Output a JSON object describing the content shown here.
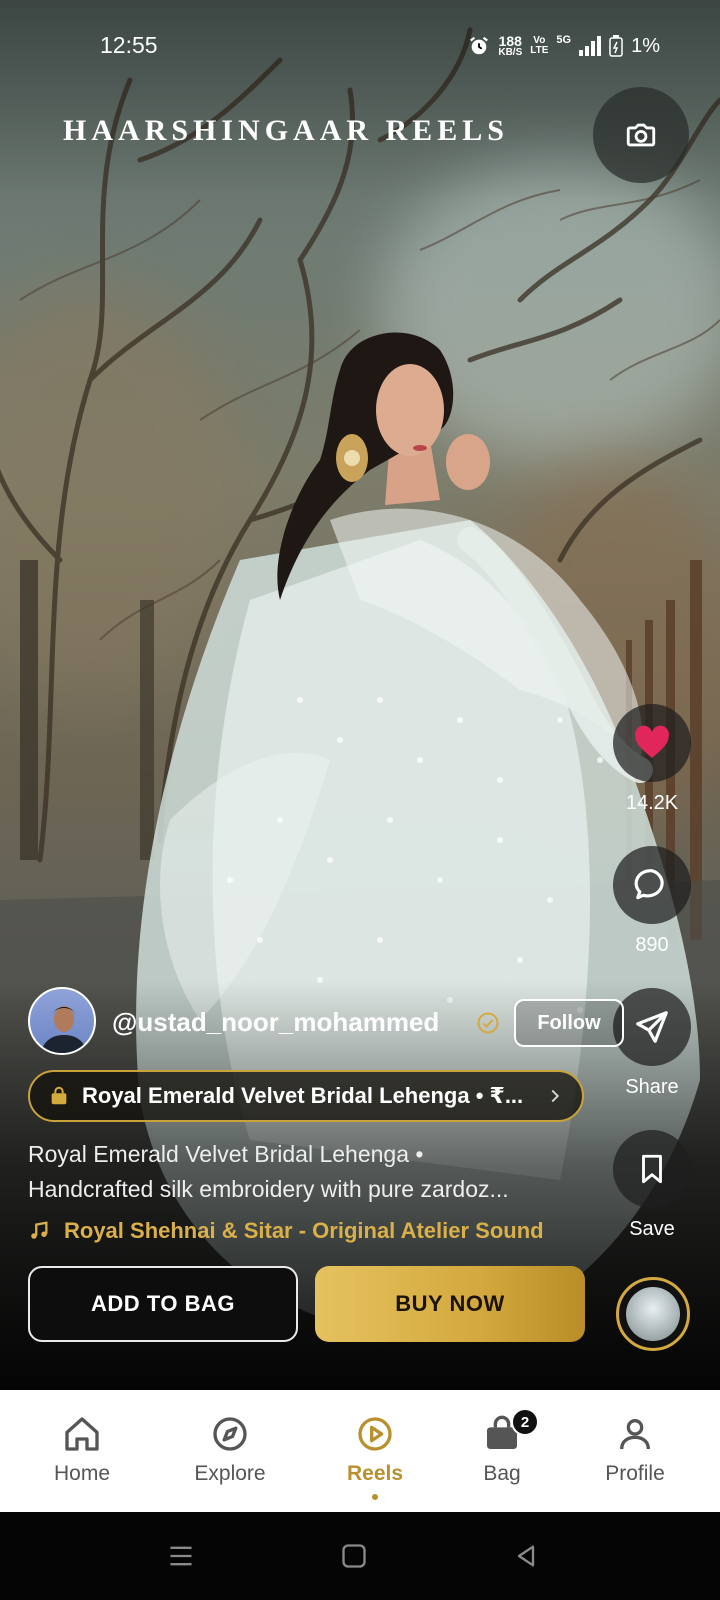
{
  "status_bar": {
    "time": "12:55",
    "speed_value": "188",
    "speed_unit": "KB/S",
    "volte_top": "Vo",
    "volte_bottom": "LTE",
    "network": "5G",
    "battery": "1%"
  },
  "header": {
    "title": "HAARSHINGAAR REELS",
    "camera_icon": "camera-icon"
  },
  "actions": {
    "like_count": "14.2K",
    "comment_count": "890",
    "share_label": "Share",
    "save_label": "Save"
  },
  "creator": {
    "username": "@ustad_noor_mohammed",
    "follow_label": "Follow"
  },
  "product": {
    "pill_text": "Royal Emerald Velvet Bridal Lehenga • ₹...",
    "caption_line1": "Royal Emerald Velvet Bridal Lehenga •",
    "caption_line2": "Handcrafted silk embroidery with pure zardoz...",
    "sound": "Royal Shehnai & Sitar - Original Atelier Sound"
  },
  "cta": {
    "add_to_bag": "ADD TO BAG",
    "buy_now": "BUY NOW"
  },
  "bottom_nav": {
    "items": [
      {
        "label": "Home",
        "icon": "home-icon"
      },
      {
        "label": "Explore",
        "icon": "compass-icon"
      },
      {
        "label": "Reels",
        "icon": "play-circle-icon",
        "active": true
      },
      {
        "label": "Bag",
        "icon": "bag-icon",
        "badge": "2"
      },
      {
        "label": "Profile",
        "icon": "profile-icon"
      }
    ]
  },
  "colors": {
    "accent_gold": "#d4a93f",
    "like_red": "#e0265a",
    "nav_active": "#b8902e"
  }
}
